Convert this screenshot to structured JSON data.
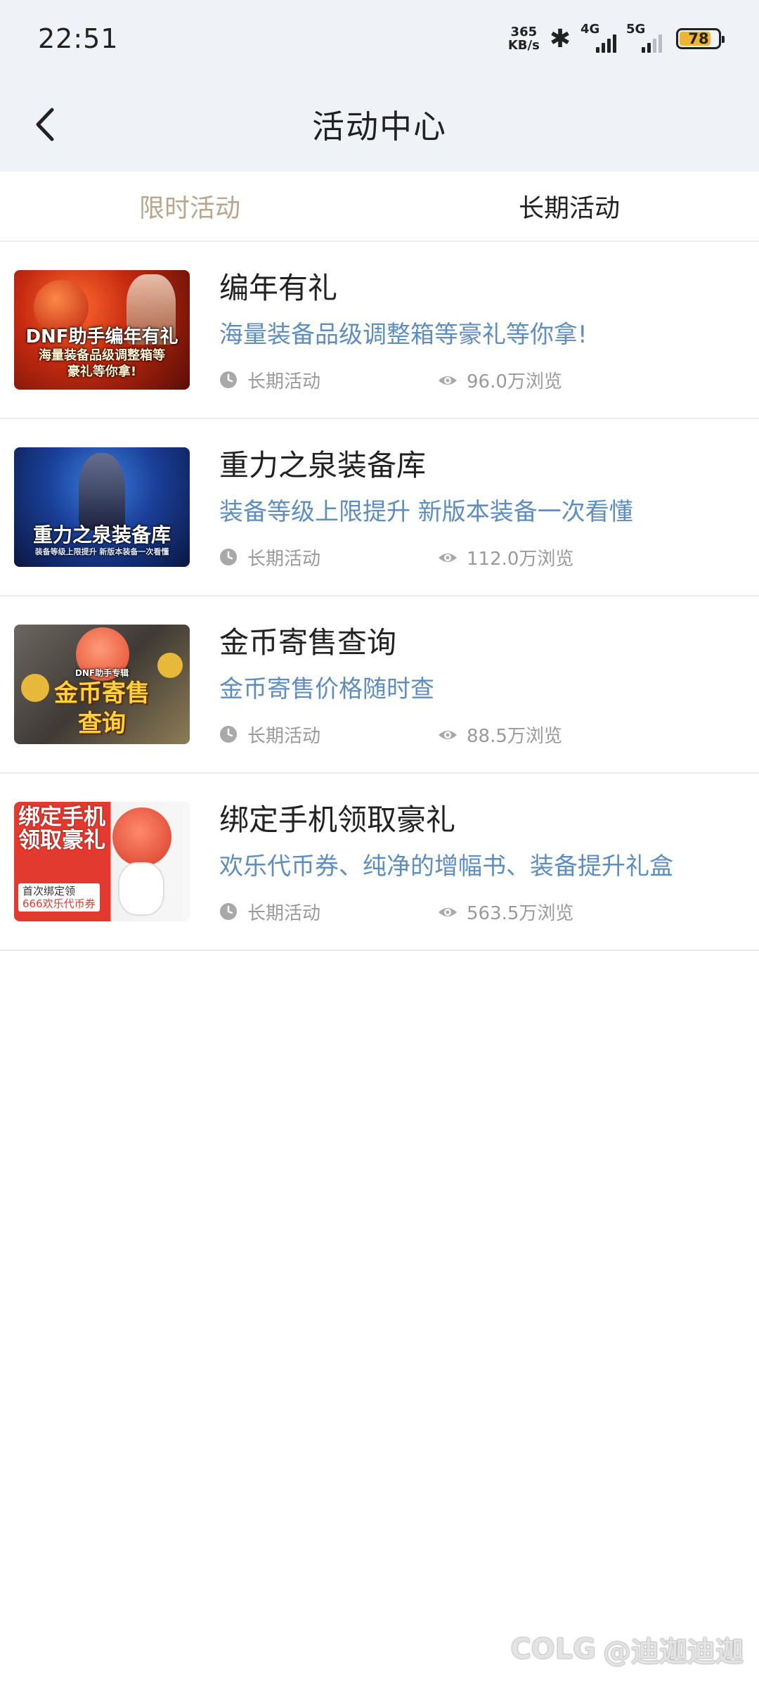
{
  "status": {
    "time": "22:51",
    "net_speed_value": "365",
    "net_speed_unit": "KB/s",
    "sig1_label": "4G",
    "sig2_label": "5G",
    "battery": "78"
  },
  "nav": {
    "title": "活动中心"
  },
  "tabs": [
    {
      "label": "限时活动"
    },
    {
      "label": "长期活动"
    }
  ],
  "items": [
    {
      "title": "编年有礼",
      "desc": "海量装备品级调整箱等豪礼等你拿!",
      "type": "长期活动",
      "views": "96.0万浏览",
      "thumb_text": [
        "DNF助手编年有礼",
        "海量装备品级调整箱等",
        "豪礼等你拿!"
      ]
    },
    {
      "title": "重力之泉装备库",
      "desc": "装备等级上限提升 新版本装备一次看懂",
      "type": "长期活动",
      "views": "112.0万浏览",
      "thumb_text": [
        "重力之泉装备库",
        "装备等级上限提升 新版本装备一次看懂"
      ]
    },
    {
      "title": "金币寄售查询",
      "desc": "金币寄售价格随时查",
      "type": "长期活动",
      "views": "88.5万浏览",
      "thumb_text": [
        "DNF助手专辑",
        "金币寄售",
        "查询"
      ]
    },
    {
      "title": "绑定手机领取豪礼",
      "desc": "欢乐代币券、纯净的增幅书、装备提升礼盒",
      "type": "长期活动",
      "views": "563.5万浏览",
      "thumb_text": [
        "绑定手机",
        "领取豪礼",
        "首次绑定领",
        "666欢乐代币券"
      ]
    }
  ],
  "watermark": {
    "logo": "COLG",
    "user": "@迪迦迪迦"
  },
  "colors": {
    "header_bg": "#eff2f7",
    "desc_blue": "#5e8dbf",
    "inactive_tab": "#b8a78d",
    "meta_gray": "#9a9a9a"
  }
}
